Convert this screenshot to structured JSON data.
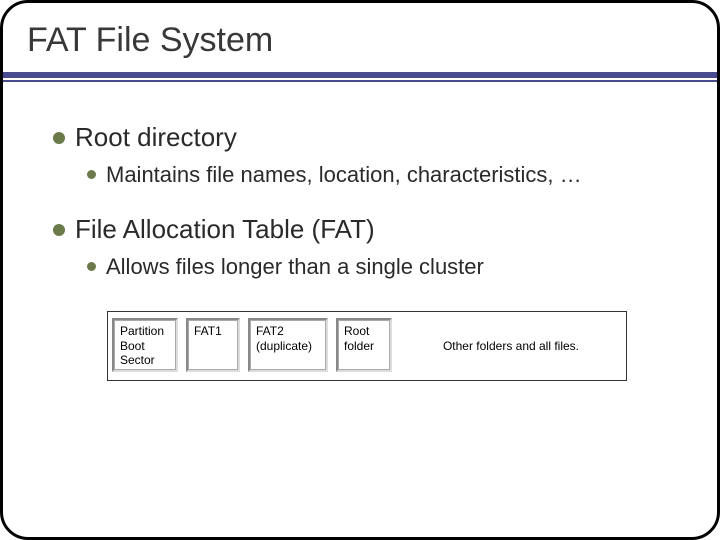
{
  "title": "FAT File System",
  "bullets": {
    "b1": {
      "text": "Root directory"
    },
    "b1_1": {
      "text": "Maintains file names, location, characteristics, …"
    },
    "b2": {
      "text": "File Allocation Table (FAT)"
    },
    "b2_1": {
      "text": "Allows files longer than a single cluster"
    }
  },
  "diagram": {
    "pbs": "Partition\nBoot\nSector",
    "fat1": "FAT1",
    "fat2": "FAT2\n(duplicate)",
    "root": "Root\nfolder",
    "rest": "Other folders and all files."
  }
}
